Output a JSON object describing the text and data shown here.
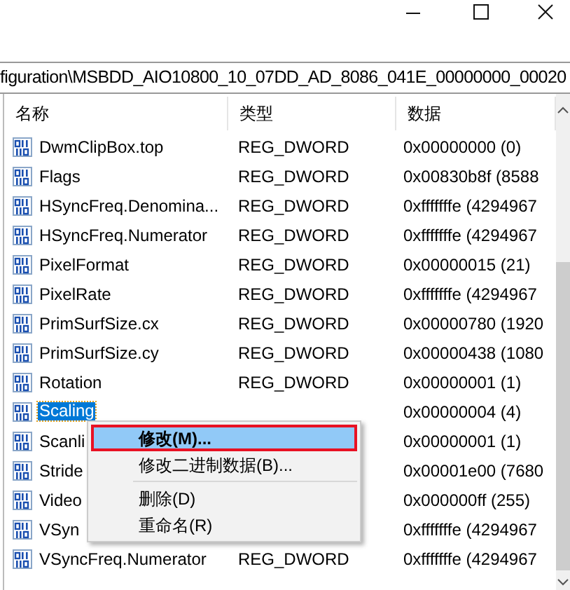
{
  "address_bar": {
    "path": "figuration\\MSBDD_AIO10800_10_07DD_AD_8086_041E_00000000_00020"
  },
  "table": {
    "columns": [
      "名称",
      "类型",
      "数据"
    ],
    "rows": [
      {
        "name": "DwmClipBox.top",
        "type": "REG_DWORD",
        "data": "0x00000000 (0)",
        "selected": false
      },
      {
        "name": "Flags",
        "type": "REG_DWORD",
        "data": "0x00830b8f (8588",
        "selected": false
      },
      {
        "name": "HSyncFreq.Denomina...",
        "type": "REG_DWORD",
        "data": "0xfffffffe (4294967",
        "selected": false
      },
      {
        "name": "HSyncFreq.Numerator",
        "type": "REG_DWORD",
        "data": "0xfffffffe (4294967",
        "selected": false
      },
      {
        "name": "PixelFormat",
        "type": "REG_DWORD",
        "data": "0x00000015 (21)",
        "selected": false
      },
      {
        "name": "PixelRate",
        "type": "REG_DWORD",
        "data": "0xfffffffe (4294967",
        "selected": false
      },
      {
        "name": "PrimSurfSize.cx",
        "type": "REG_DWORD",
        "data": "0x00000780 (1920",
        "selected": false
      },
      {
        "name": "PrimSurfSize.cy",
        "type": "REG_DWORD",
        "data": "0x00000438 (1080",
        "selected": false
      },
      {
        "name": "Rotation",
        "type": "REG_DWORD",
        "data": "0x00000001 (1)",
        "selected": false
      },
      {
        "name": "Scaling",
        "data": "0x00000004 (4)",
        "selected": true
      },
      {
        "name": "Scanli",
        "data": "0x00000001 (1)",
        "selected": false
      },
      {
        "name": "Stride",
        "data": "0x00001e00 (7680",
        "selected": false
      },
      {
        "name": "Video",
        "data": "0x000000ff (255)",
        "selected": false
      },
      {
        "name": "VSyn",
        "data": "0xfffffffe (4294967",
        "selected": false
      },
      {
        "name": "VSyncFreq.Numerator",
        "type": "REG_DWORD",
        "data": "0xfffffffe (4294967",
        "selected": false
      }
    ]
  },
  "context_menu": {
    "items": [
      {
        "kind": "item",
        "label": "修改(M)...",
        "default": true,
        "selected": true
      },
      {
        "kind": "item",
        "label": "修改二进制数据(B)...",
        "default": false,
        "selected": false
      },
      {
        "kind": "separator"
      },
      {
        "kind": "item",
        "label": "删除(D)",
        "default": false,
        "selected": false
      },
      {
        "kind": "item",
        "label": "重命名(R)",
        "default": false,
        "selected": false
      }
    ]
  }
}
